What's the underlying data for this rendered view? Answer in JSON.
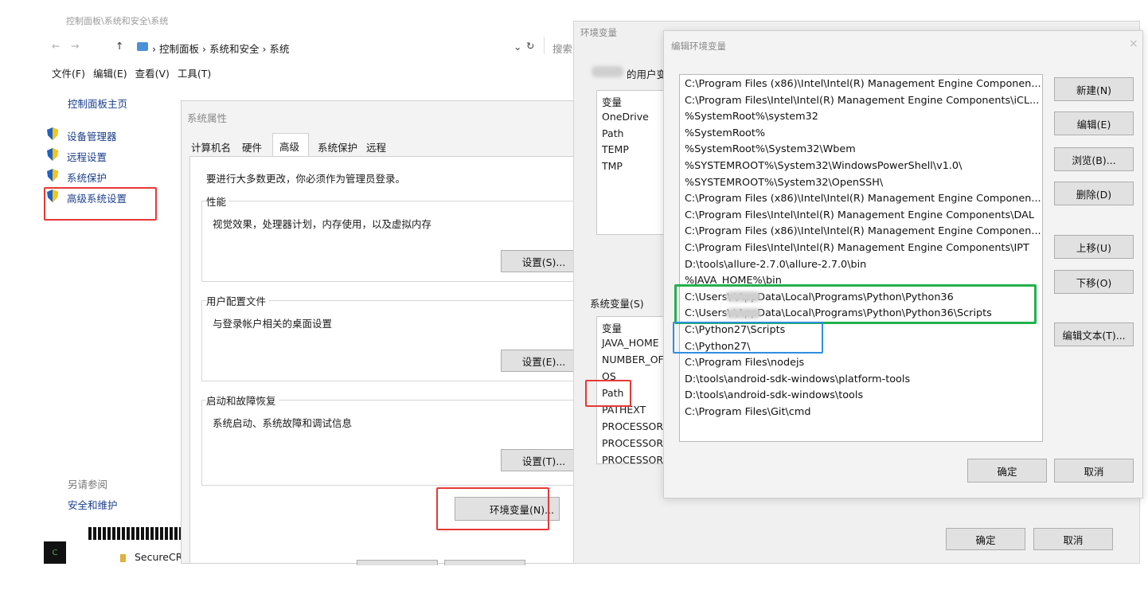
{
  "explorer": {
    "title": "控制面板\\系统和安全\\系统",
    "breadcrumb": [
      "控制面板",
      "系统和安全",
      "系统"
    ],
    "search_placeholder": "搜索",
    "menu": [
      "文件(F)",
      "编辑(E)",
      "查看(V)",
      "工具(T)"
    ],
    "sidebar": {
      "home": "控制面板主页",
      "items": [
        "设备管理器",
        "远程设置",
        "系统保护",
        "高级系统设置"
      ],
      "see_also": "另请参阅",
      "see_also_item": "安全和维护"
    }
  },
  "sysprops": {
    "title": "系统属性",
    "tabs": [
      "计算机名",
      "硬件",
      "高级",
      "系统保护",
      "远程"
    ],
    "admin_note": "要进行大多数更改，你必须作为管理员登录。",
    "perf": {
      "title": "性能",
      "desc": "视觉效果，处理器计划，内存使用，以及虚拟内存",
      "button": "设置(S)..."
    },
    "profile": {
      "title": "用户配置文件",
      "desc": "与登录帐户相关的桌面设置",
      "button": "设置(E)..."
    },
    "startup": {
      "title": "启动和故障恢复",
      "desc": "系统启动、系统故障和调试信息",
      "button": "设置(T)..."
    },
    "env_button": "环境变量(N)..."
  },
  "envvars": {
    "title": "环境变量",
    "user_section": "的用户变",
    "user_header": "变量",
    "user_vars": [
      "OneDrive",
      "Path",
      "TEMP",
      "TMP"
    ],
    "system_section": "系统变量(S)",
    "system_header": "变量",
    "system_vars": [
      "JAVA_HOME",
      "NUMBER_OF",
      "OS",
      "Path",
      "PATHEXT",
      "PROCESSOR",
      "PROCESSOR",
      "PROCESSOR"
    ],
    "ok": "确定",
    "cancel": "取消"
  },
  "editvar": {
    "title": "编辑环境变量",
    "paths": [
      "C:\\Program Files (x86)\\Intel\\Intel(R) Management Engine Componen...",
      "C:\\Program Files\\Intel\\Intel(R) Management Engine Components\\iCL...",
      "%SystemRoot%\\system32",
      "%SystemRoot%",
      "%SystemRoot%\\System32\\Wbem",
      "%SYSTEMROOT%\\System32\\WindowsPowerShell\\v1.0\\",
      "%SYSTEMROOT%\\System32\\OpenSSH\\",
      "C:\\Program Files (x86)\\Intel\\Intel(R) Management Engine Componen...",
      "C:\\Program Files\\Intel\\Intel(R) Management Engine Components\\DAL",
      "C:\\Program Files (x86)\\Intel\\Intel(R) Management Engine Componen...",
      "C:\\Program Files\\Intel\\Intel(R) Management Engine Components\\IPT",
      "D:\\tools\\allure-2.7.0\\allure-2.7.0\\bin",
      "%JAVA_HOME%\\bin",
      "C:\\Users\\        \\AppData\\Local\\Programs\\Python\\Python36",
      "C:\\Users\\        \\AppData\\Local\\Programs\\Python\\Python36\\Scripts",
      "C:\\Python27\\Scripts",
      "C:\\Python27\\",
      "C:\\Program Files\\nodejs",
      "D:\\tools\\android-sdk-windows\\platform-tools",
      "D:\\tools\\android-sdk-windows\\tools",
      "C:\\Program Files\\Git\\cmd"
    ],
    "buttons": [
      "新建(N)",
      "编辑(E)",
      "浏览(B)...",
      "删除(D)",
      "上移(U)",
      "下移(O)",
      "编辑文本(T)..."
    ],
    "ok": "确定",
    "cancel": "取消"
  },
  "taskbar": {
    "app_label": "SecureCR",
    "badge": "C"
  }
}
